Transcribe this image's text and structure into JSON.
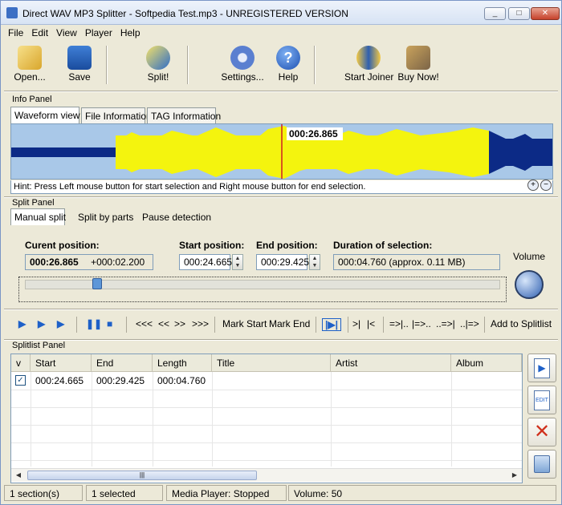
{
  "window": {
    "title": "Direct WAV MP3 Splitter - Softpedia Test.mp3 - UNREGISTERED VERSION",
    "minimize": "_",
    "maximize": "□",
    "close": "✕"
  },
  "menu": [
    "File",
    "Edit",
    "View",
    "Player",
    "Help"
  ],
  "toolbar": {
    "open": "Open...",
    "save": "Save",
    "split": "Split!",
    "settings": "Settings...",
    "help": "Help",
    "start_joiner": "Start Joiner",
    "buy_now": "Buy Now!"
  },
  "info_panel": {
    "label": "Info Panel",
    "tabs": [
      "Waveform view",
      "File Information",
      "TAG Information"
    ],
    "cursor_time": "000:26.865",
    "hint": "Hint: Press Left mouse button for start selection and Right mouse button for end selection."
  },
  "split_panel": {
    "label": "Split Panel",
    "tabs": [
      "Manual split",
      "Split by parts",
      "Pause detection"
    ],
    "current_position_label": "Curent position:",
    "current_position": "000:26.865",
    "current_offset": "+000:02.200",
    "start_position_label": "Start position:",
    "start_position": "000:24.665",
    "end_position_label": "End position:",
    "end_position": "000:29.425",
    "duration_label": "Duration of selection:",
    "duration": "000:04.760  (approx. 0.11 MB)",
    "volume_label": "Volume"
  },
  "transport": {
    "mark_start": "Mark Start",
    "mark_end": "Mark End",
    "rewind_far": "<<<",
    "rewind": "<<",
    "forward": ">>",
    "forward_far": ">>>",
    "go_start": ">|",
    "go_end": "|<",
    "split_a": "=>|..",
    "split_b": "|=>..",
    "split_c": "..=>|",
    "split_d": "..|=>",
    "add_to_splitlist": "Add to Splitlist"
  },
  "splitlist": {
    "label": "Splitlist Panel",
    "columns": [
      "v",
      "Start",
      "End",
      "Length",
      "Title",
      "Artist",
      "Album"
    ],
    "rows": [
      {
        "checked": "✓",
        "start": "000:24.665",
        "end": "000:29.425",
        "length": "000:04.760",
        "title": "",
        "artist": "",
        "album": ""
      }
    ]
  },
  "status": {
    "sections": "1 section(s)",
    "selected": "1 selected",
    "player": "Media Player: Stopped",
    "volume": "Volume: 50"
  },
  "colors": {
    "waveform_bg": "#a9c8e8",
    "waveform_dark": "#0c2a86",
    "waveform_selected": "#f4f40e",
    "cursor_line": "#d02020"
  }
}
